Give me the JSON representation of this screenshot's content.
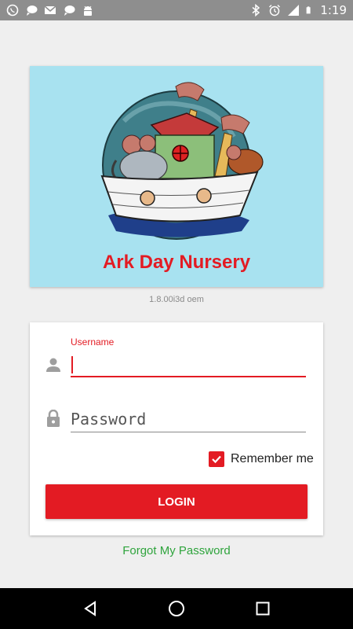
{
  "status_bar": {
    "time": "1:19",
    "left_icons": [
      "whatsapp-icon",
      "chat-bubble-icon",
      "gmail-icon",
      "chat-bubble-icon",
      "android-icon"
    ],
    "right_icons": [
      "bluetooth-icon",
      "alarm-icon",
      "signal-icon",
      "battery-icon"
    ]
  },
  "logo": {
    "brand_name": "Ark Day Nursery",
    "background_color": "#a8e2f0",
    "brand_color": "#e31b23"
  },
  "version": "1.8.00i3d oem",
  "login": {
    "username_label": "Username",
    "username_value": "",
    "password_placeholder": "Password",
    "remember_label": "Remember me",
    "remember_checked": true,
    "login_button": "LOGIN"
  },
  "forgot_link": "Forgot My Password",
  "colors": {
    "accent": "#e31b23",
    "link": "#2fa43d",
    "statusbar": "#8e8e8e",
    "navbar": "#000000"
  },
  "nav_icons": [
    "back-icon",
    "home-icon",
    "recents-icon"
  ]
}
